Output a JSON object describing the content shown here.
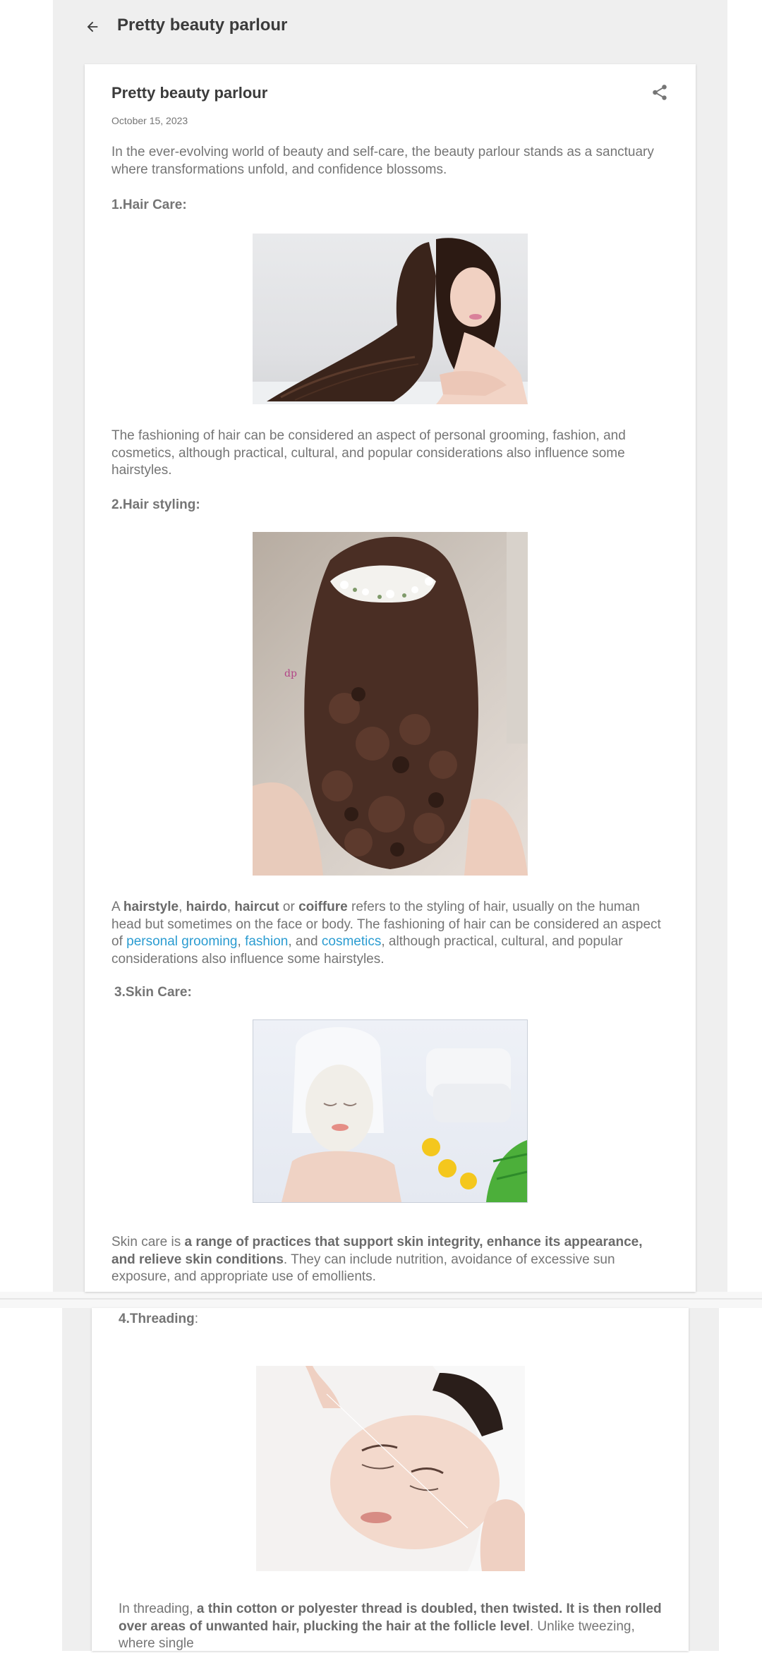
{
  "topbar": {
    "title": "Pretty beauty parlour"
  },
  "post": {
    "title": "Pretty beauty parlour",
    "date": "October 15, 2023",
    "intro": "In the ever-evolving world of beauty and self-care, the beauty parlour stands as a sanctuary where transformations unfold, and confidence blossoms.",
    "s1": {
      "heading": "1.Hair Care:",
      "text": "The fashioning of hair can be considered an aspect of personal grooming, fashion, and cosmetics, although practical, cultural, and popular considerations also influence some hairstyles."
    },
    "s2": {
      "heading": "2.Hair styling:",
      "t1": "A ",
      "b1": "hairstyle",
      "t2": ", ",
      "b2": "hairdo",
      "t3": ", ",
      "b3": "haircut",
      "t4": " or ",
      "b4": "coiffure",
      "t5": " refers to the styling of hair, usually on the human head but sometimes on the face or body. The fashioning of hair can be considered an aspect of ",
      "l1": "personal grooming",
      "t6": ", ",
      "l2": "fashion",
      "t7": ", and ",
      "l3": "cosmetics",
      "t8": ", although practical, cultural, and popular considerations also influence some hairstyles."
    },
    "s3": {
      "heading": "3.Skin Care:",
      "t1": "Skin care is ",
      "b1": "a range of practices that support skin integrity, enhance its appearance, and relieve skin conditions",
      "t2": ". They can include nutrition, avoidance of excessive sun exposure, and appropriate use of emollients."
    },
    "s4": {
      "heading": "4.Threading",
      "colon": ":",
      "t1": "In threading, ",
      "b1": "a thin cotton or polyester thread is doubled, then twisted. It is then rolled over areas of unwanted hair, plucking the hair at the follicle level",
      "t2": ". Unlike tweezing, where single"
    }
  },
  "colors": {
    "link": "#2b9cd1",
    "background": "#efefef",
    "card": "#ffffff"
  },
  "icons": [
    "back-arrow-icon",
    "share-icon"
  ]
}
